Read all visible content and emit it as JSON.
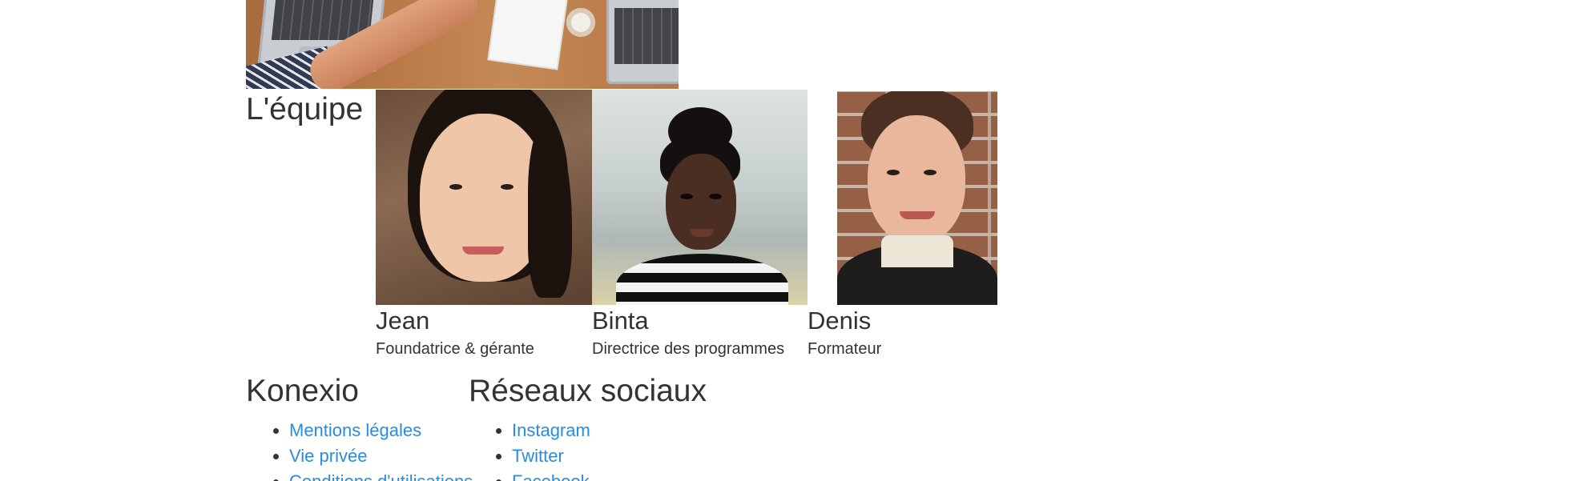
{
  "hero": {
    "alt_name": "desk-collaboration-image"
  },
  "team": {
    "heading": "L'équipe",
    "members": [
      {
        "name": "Jean",
        "role": "Foundatrice & gérante"
      },
      {
        "name": "Binta",
        "role": "Directrice des programmes"
      },
      {
        "name": "Denis",
        "role": "Formateur"
      }
    ]
  },
  "footer": {
    "konexio": {
      "title": "Konexio",
      "links": [
        "Mentions légales",
        "Vie privée",
        "Conditions d'utilisations"
      ]
    },
    "social": {
      "title": "Réseaux sociaux",
      "links": [
        "Instagram",
        "Twitter",
        "Facebook"
      ]
    }
  },
  "colors": {
    "link": "#2b8be0",
    "text": "#333333",
    "background": "#ffffff"
  }
}
